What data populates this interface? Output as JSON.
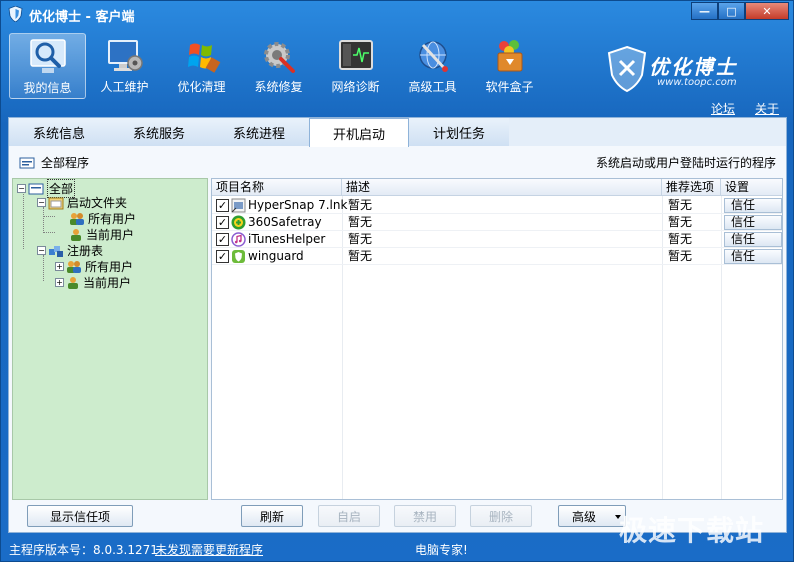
{
  "window": {
    "title": "优化博士 - 客户端",
    "controls": [
      "—",
      "□",
      "✕"
    ]
  },
  "toolbar": {
    "items": [
      {
        "label": "我的信息",
        "icon": "magnifier-icon",
        "active": true
      },
      {
        "label": "人工维护",
        "icon": "monitor-gear-icon",
        "active": false
      },
      {
        "label": "优化清理",
        "icon": "windows-flag-icon",
        "active": false
      },
      {
        "label": "系统修复",
        "icon": "gear-repair-icon",
        "active": false
      },
      {
        "label": "网络诊断",
        "icon": "network-monitor-icon",
        "active": false
      },
      {
        "label": "高级工具",
        "icon": "globe-tool-icon",
        "active": false
      },
      {
        "label": "软件盒子",
        "icon": "software-box-icon",
        "active": false
      }
    ]
  },
  "brand": {
    "name": "优化博士",
    "url": "www.toopc.com"
  },
  "toplinks": {
    "forum": "论坛",
    "about": "关于"
  },
  "tabs": [
    {
      "label": "系统信息",
      "active": false
    },
    {
      "label": "系统服务",
      "active": false
    },
    {
      "label": "系统进程",
      "active": false
    },
    {
      "label": "开机启动",
      "active": true
    },
    {
      "label": "计划任务",
      "active": false
    }
  ],
  "subheader": {
    "left": "全部程序",
    "right": "系统启动或用户登陆时运行的程序"
  },
  "tree": {
    "root": "全部",
    "startup_folder": "启动文件夹",
    "sf_all_users": "所有用户",
    "sf_current_user": "当前用户",
    "registry": "注册表",
    "rg_all_users": "所有用户",
    "rg_current_user": "当前用户"
  },
  "grid": {
    "columns": [
      "项目名称",
      "描述",
      "推荐选项",
      "设置"
    ],
    "rows": [
      {
        "name": "HyperSnap 7.lnk",
        "desc": "暂无",
        "rec": "暂无",
        "action": "信任",
        "checked": true,
        "icon": "hypersnap-icon"
      },
      {
        "name": "360Safetray",
        "desc": "暂无",
        "rec": "暂无",
        "action": "信任",
        "checked": true,
        "icon": "360-shield-icon"
      },
      {
        "name": "iTunesHelper",
        "desc": "暂无",
        "rec": "暂无",
        "action": "信任",
        "checked": true,
        "icon": "itunes-icon"
      },
      {
        "name": "winguard",
        "desc": "暂无",
        "rec": "暂无",
        "action": "信任",
        "checked": true,
        "icon": "winguard-icon"
      }
    ]
  },
  "buttons": {
    "show_trusted": "显示信任项",
    "refresh": "刷新",
    "self_start": "自启",
    "disable": "禁用",
    "delete": "删除",
    "advanced": "高级"
  },
  "status": {
    "version_label": "主程序版本号：",
    "version": "8.0.3.1271",
    "update_link": "未发现需要更新程序",
    "message": "电脑专家!"
  },
  "watermark": "极速下载站",
  "colors": {
    "frame_blue": "#1a6cc7",
    "tree_green": "#cdeccd",
    "panel": "#e4eef9"
  }
}
